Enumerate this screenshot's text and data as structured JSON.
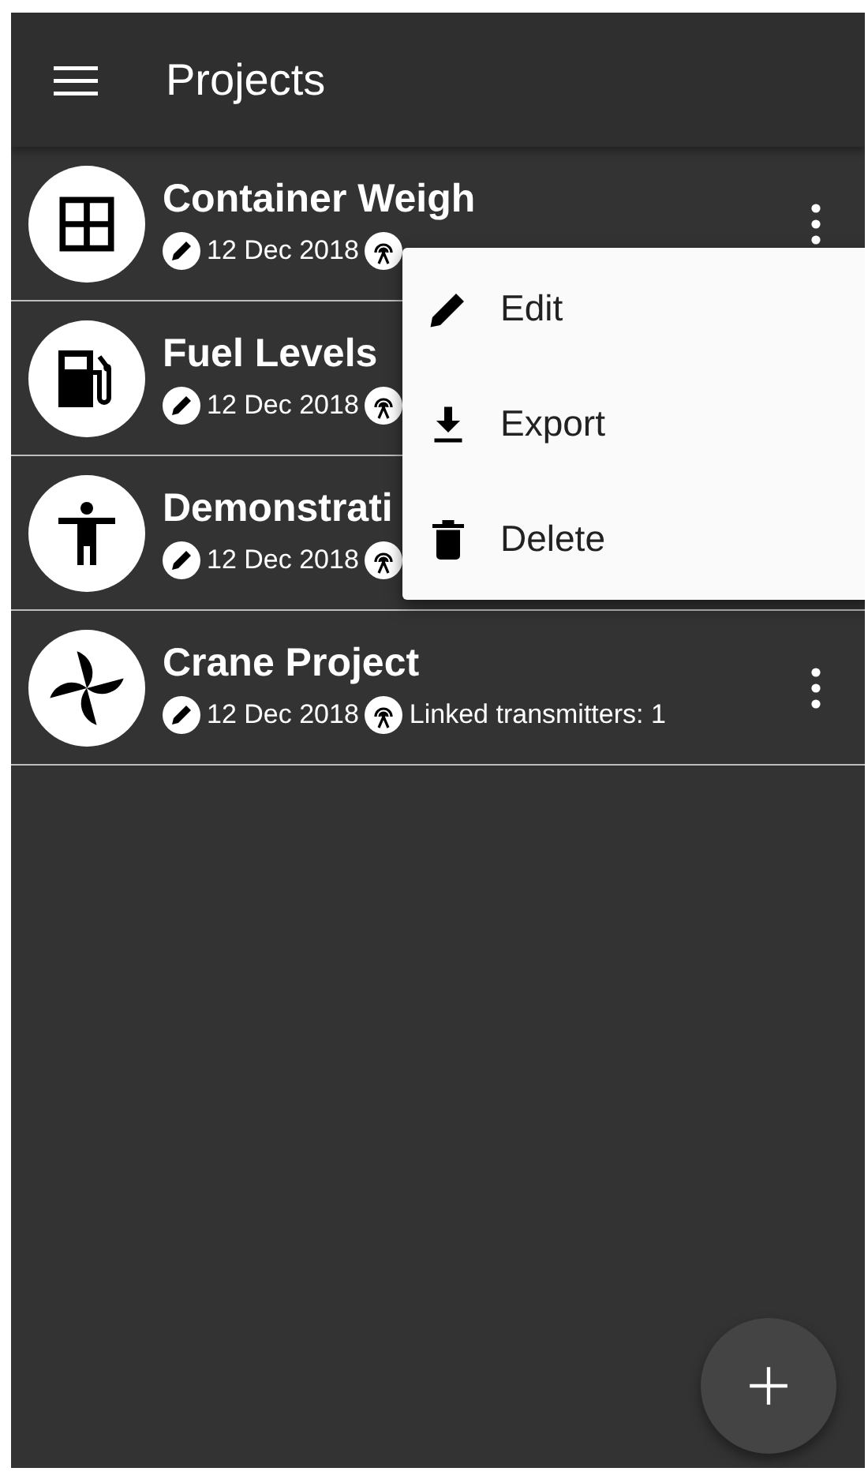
{
  "app_bar": {
    "title": "Projects"
  },
  "projects": [
    {
      "kind": "grid",
      "name": "Container Weigh",
      "date": "12 Dec 2018"
    },
    {
      "kind": "fuel",
      "name": "Fuel Levels",
      "date": "12 Dec 2018"
    },
    {
      "kind": "person",
      "name": "Demonstrati",
      "date": "12 Dec 2018"
    },
    {
      "kind": "fan",
      "name": "Crane Project",
      "date": "12 Dec 2018",
      "transmitters": "Linked transmitters: 1"
    }
  ],
  "context_menu": {
    "open": true,
    "items": [
      {
        "kind": "edit",
        "label": "Edit"
      },
      {
        "kind": "export",
        "label": "Export"
      },
      {
        "kind": "delete",
        "label": "Delete"
      }
    ]
  },
  "fab": {
    "kind": "add"
  }
}
